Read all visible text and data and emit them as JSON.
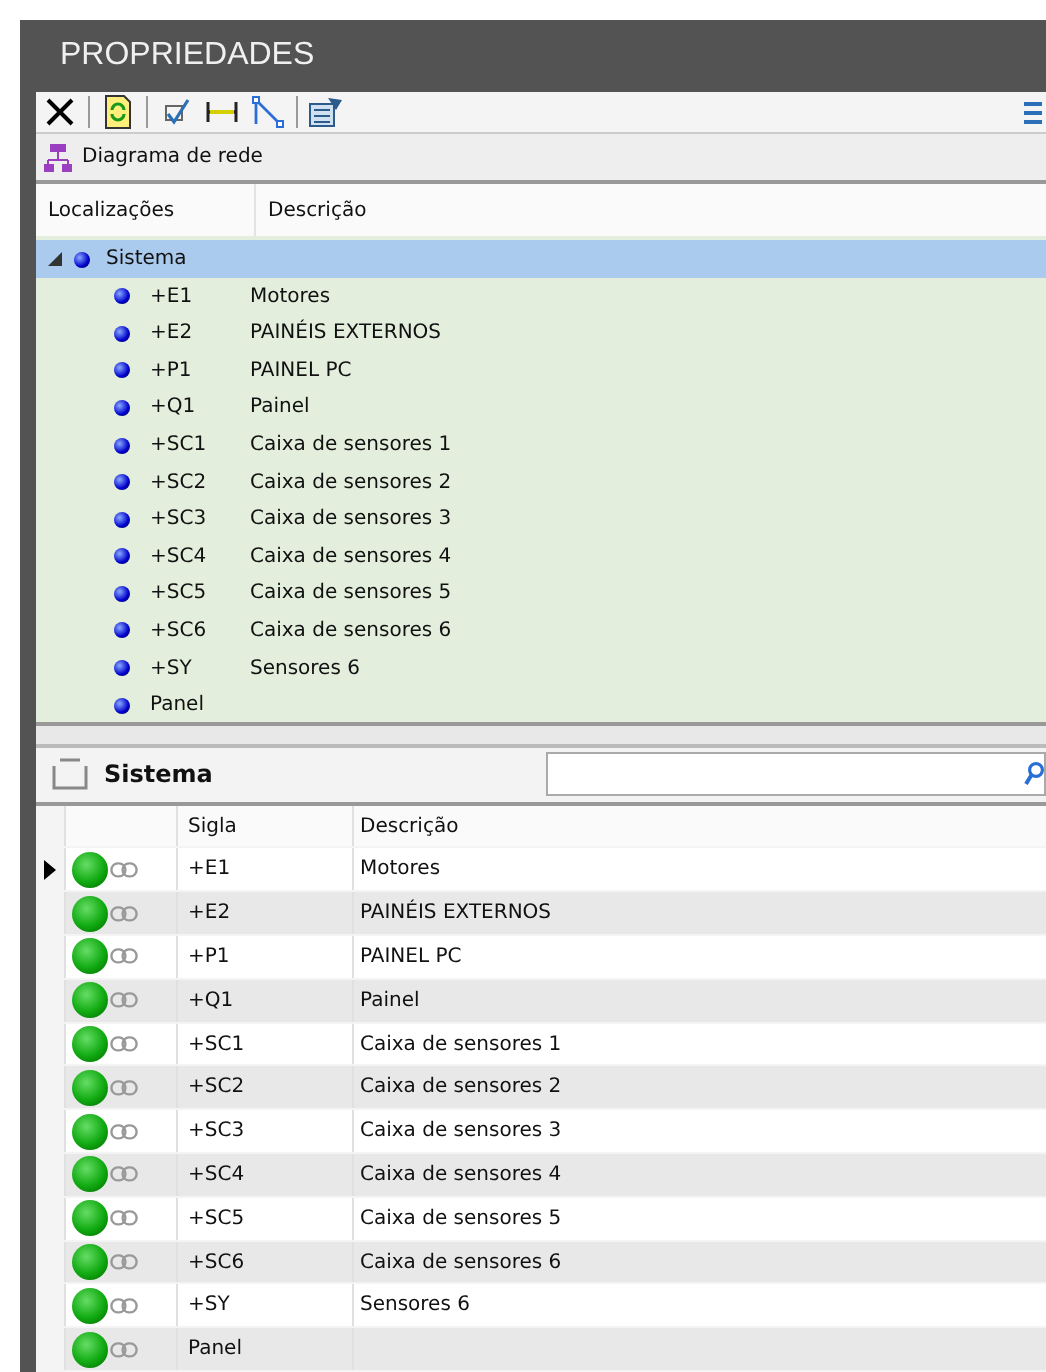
{
  "panel": {
    "title": "PROPRIEDADES"
  },
  "toolbar": {
    "buttons": [
      {
        "kind": "delete"
      },
      {
        "kind": "sep"
      },
      {
        "kind": "refresh"
      },
      {
        "kind": "sep"
      },
      {
        "kind": "check"
      },
      {
        "kind": "dimension"
      },
      {
        "kind": "line"
      },
      {
        "kind": "sep"
      },
      {
        "kind": "properties"
      }
    ]
  },
  "view_selector": {
    "value": "Diagrama de rede"
  },
  "tree": {
    "columns": [
      "Localizações",
      "Descrição"
    ],
    "items": [
      {
        "label": "Sistema",
        "expanded": true,
        "selected": true,
        "children": [
          {
            "code": "+E1",
            "description": "Motores"
          },
          {
            "code": "+E2",
            "description": "PAINÉIS EXTERNOS"
          },
          {
            "code": "+P1",
            "description": "PAINEL PC"
          },
          {
            "code": "+Q1",
            "description": "Painel"
          },
          {
            "code": "+SC1",
            "description": "Caixa de sensores 1"
          },
          {
            "code": "+SC2",
            "description": "Caixa de sensores 2"
          },
          {
            "code": "+SC3",
            "description": "Caixa de sensores 3"
          },
          {
            "code": "+SC4",
            "description": "Caixa de sensores 4"
          },
          {
            "code": "+SC5",
            "description": "Caixa de sensores 5"
          },
          {
            "code": "+SC6",
            "description": "Caixa de sensores 6"
          },
          {
            "code": "+SY",
            "description": "Sensores 6"
          },
          {
            "code": "Panel"
          }
        ]
      }
    ]
  },
  "detail": {
    "title": "Sistema",
    "columns": [
      "Sigla",
      "Descrição"
    ],
    "rows": [
      {
        "sigla": "+E1",
        "descricao": "Motores",
        "current": true
      },
      {
        "sigla": "+E2",
        "descricao": "PAINÉIS EXTERNOS",
        "current": false
      },
      {
        "sigla": "+P1",
        "descricao": "PAINEL PC",
        "current": false
      },
      {
        "sigla": "+Q1",
        "descricao": "Painel",
        "current": false
      },
      {
        "sigla": "+SC1",
        "descricao": "Caixa de sensores 1",
        "current": false
      },
      {
        "sigla": "+SC2",
        "descricao": "Caixa de sensores 2",
        "current": false
      },
      {
        "sigla": "+SC3",
        "descricao": "Caixa de sensores 3",
        "current": false
      },
      {
        "sigla": "+SC4",
        "descricao": "Caixa de sensores 4",
        "current": false
      },
      {
        "sigla": "+SC5",
        "descricao": "Caixa de sensores 5",
        "current": false
      },
      {
        "sigla": "+SC6",
        "descricao": "Caixa de sensores 6",
        "current": false
      },
      {
        "sigla": "+SY",
        "descricao": "Sensores 6",
        "current": false
      },
      {
        "sigla": "Panel",
        "current": false
      }
    ]
  }
}
